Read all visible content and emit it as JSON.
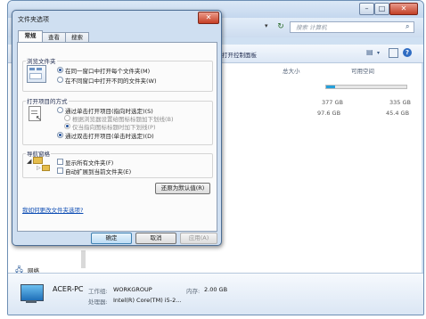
{
  "dialog": {
    "title": "文件夹选项",
    "tabs": [
      "常规",
      "查看",
      "搜索"
    ],
    "browse_group": {
      "label": "浏览文件夹",
      "options": [
        "在同一窗口中打开每个文件夹(M)",
        "在不同窗口中打开不同的文件夹(W)"
      ]
    },
    "click_group": {
      "label": "打开项目的方式",
      "options": [
        "通过单击打开项目(指向时选定)(S)",
        "根据浏览器设置给图标标题加下划线(B)",
        "仅当指向图标标题时加下划线(P)",
        "通过双击打开项目(单击时选定)(D)"
      ]
    },
    "nav_group": {
      "label": "导航窗格",
      "options": [
        "显示所有文件夹(F)",
        "自动扩展到当前文件夹(E)"
      ]
    },
    "restore_label": "还原为默认值(R)",
    "help_link": "我如何更改文件夹选项?",
    "buttons": {
      "ok": "确定",
      "cancel": "取消",
      "apply": "应用(A)"
    }
  },
  "explorer": {
    "search_placeholder": "搜索 计算机",
    "toolbar_text": "打开控制面板",
    "columns": [
      "总大小",
      "可用空间"
    ],
    "drives": [
      {
        "total": "377 GB",
        "free": "335 GB",
        "free_fraction": 0.89
      },
      {
        "total": "97.6 GB",
        "free": "45.4 GB",
        "free_fraction": 0.47
      }
    ],
    "nav_network": "网络",
    "details": {
      "pc_name": "ACER-PC",
      "workgroup_label": "工作组:",
      "workgroup": "WORKGROUP",
      "memory_label": "内存:",
      "memory": "2.00 GB",
      "cpu_label": "处理器:",
      "cpu": "Intel(R) Core(TM) i5-2..."
    }
  },
  "colors": {
    "dialog_bg": "#cfdff1",
    "accent": "#1f4f9b",
    "link": "#0b4bb3"
  }
}
